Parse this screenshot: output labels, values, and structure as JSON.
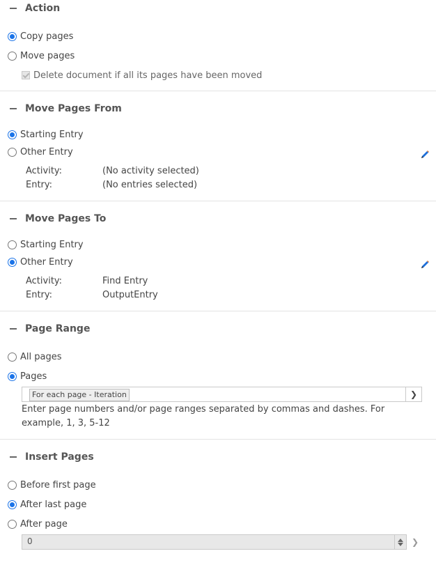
{
  "action": {
    "title": "Action",
    "options": [
      {
        "label": "Copy pages",
        "checked": true
      },
      {
        "label": "Move pages",
        "checked": false
      }
    ],
    "delete_label": "Delete document if all its pages have been moved",
    "delete_checked": true
  },
  "move_from": {
    "title": "Move Pages From",
    "options": [
      {
        "label": "Starting Entry",
        "checked": true
      },
      {
        "label": "Other Entry",
        "checked": false
      }
    ],
    "activity_label": "Activity:",
    "activity_value": "(No activity selected)",
    "entry_label": "Entry:",
    "entry_value": "(No entries selected)"
  },
  "move_to": {
    "title": "Move Pages To",
    "options": [
      {
        "label": "Starting Entry",
        "checked": false
      },
      {
        "label": "Other Entry",
        "checked": true
      }
    ],
    "activity_label": "Activity:",
    "activity_value": "Find Entry",
    "entry_label": "Entry:",
    "entry_value": "OutputEntry"
  },
  "page_range": {
    "title": "Page Range",
    "options": [
      {
        "label": "All pages",
        "checked": false
      },
      {
        "label": "Pages",
        "checked": true
      }
    ],
    "token": "For each page - Iteration",
    "help": "Enter page numbers and/or page ranges separated by commas and dashes. For example, 1, 3, 5-12"
  },
  "insert_pages": {
    "title": "Insert Pages",
    "options": [
      {
        "label": "Before first page",
        "checked": false
      },
      {
        "label": "After last page",
        "checked": true
      },
      {
        "label": "After page",
        "checked": false
      }
    ],
    "after_page_value": "0"
  },
  "colors": {
    "accent": "#1a73e8",
    "divider": "#e3e3e3",
    "edit_icon": "#1e6fd9"
  },
  "icons": {
    "collapse": "minus-icon",
    "edit": "pencil-icon",
    "chevron": "chevron-right-icon"
  }
}
